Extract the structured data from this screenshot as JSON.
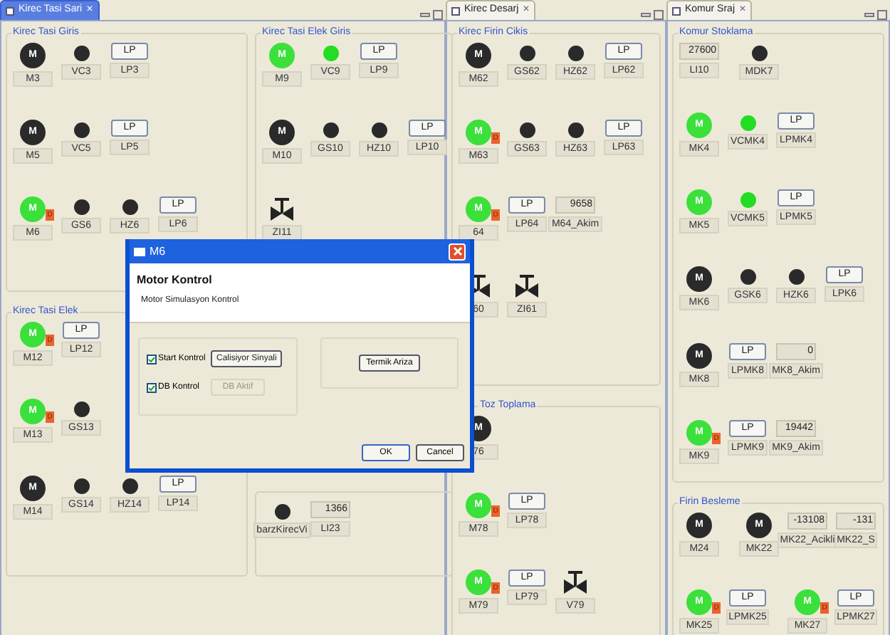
{
  "views": [
    {
      "tab": "Kirec Tasi Sari",
      "close": "✕",
      "selected": true,
      "groups": [
        {
          "title": "Kirec Tasi Giris",
          "rows": [
            [
              [
                {
                  "kind": "motor",
                  "symbol": "M",
                  "label": "M3",
                  "running": false
                },
                {
                  "kind": "indicator",
                  "label": "VC3",
                  "on": false
                },
                {
                  "kind": "lp",
                  "button": "LP",
                  "label": "LP3"
                }
              ]
            ],
            [
              [
                {
                  "kind": "motor",
                  "symbol": "M",
                  "label": "M5",
                  "running": false
                },
                {
                  "kind": "indicator",
                  "label": "VC5",
                  "on": false
                },
                {
                  "kind": "lp",
                  "button": "LP",
                  "label": "LP5"
                }
              ]
            ],
            [
              [
                {
                  "kind": "motor",
                  "symbol": "M",
                  "label": "M6",
                  "running": true,
                  "badge": "D"
                },
                {
                  "kind": "indicator",
                  "label": "GS6",
                  "on": false
                },
                {
                  "kind": "indicator",
                  "label": "HZ6",
                  "on": false
                },
                {
                  "kind": "lp",
                  "button": "LP",
                  "label": "LP6"
                }
              ]
            ]
          ]
        },
        {
          "title": "Kirec Tasi Elek Giris",
          "rows": [
            [
              [
                {
                  "kind": "motor",
                  "symbol": "M",
                  "label": "M9",
                  "running": true
                },
                {
                  "kind": "indicator",
                  "label": "VC9",
                  "on": true
                },
                {
                  "kind": "lp",
                  "button": "LP",
                  "label": "LP9"
                }
              ]
            ],
            [
              [
                {
                  "kind": "motor",
                  "symbol": "M",
                  "label": "M10",
                  "running": false
                },
                {
                  "kind": "indicator",
                  "label": "GS10",
                  "on": false
                },
                {
                  "kind": "indicator",
                  "label": "HZ10",
                  "on": false
                },
                {
                  "kind": "lp",
                  "button": "LP",
                  "label": "LP10"
                }
              ]
            ],
            [
              [
                {
                  "kind": "valve",
                  "label": "ZI11"
                }
              ]
            ]
          ]
        },
        {
          "title": "Kirec Tasi Elek",
          "rows": [
            [
              [
                {
                  "kind": "motor",
                  "symbol": "M",
                  "label": "M12",
                  "running": true,
                  "badge": "D"
                },
                {
                  "kind": "lp",
                  "button": "LP",
                  "label": "LP12"
                }
              ]
            ],
            [
              [
                {
                  "kind": "motor",
                  "symbol": "M",
                  "label": "M13",
                  "running": true,
                  "badge": "D"
                },
                {
                  "kind": "indicator",
                  "label": "GS13",
                  "on": false
                }
              ]
            ],
            [
              [
                {
                  "kind": "motor",
                  "symbol": "M",
                  "label": "M14",
                  "running": false
                },
                {
                  "kind": "indicator",
                  "label": "GS14",
                  "on": false
                },
                {
                  "kind": "indicator",
                  "label": "HZ14",
                  "on": false
                },
                {
                  "kind": "lp",
                  "button": "LP",
                  "label": "LP14"
                }
              ]
            ]
          ]
        },
        {
          "rows": [
            [
              [
                {
                  "kind": "indicator",
                  "label": "barzKirecVi",
                  "on": false
                },
                {
                  "kind": "value",
                  "value": "1366",
                  "label": "LI23"
                }
              ]
            ]
          ]
        }
      ]
    },
    {
      "tab": "Kirec Desarj",
      "close": "✕",
      "selected": false,
      "groups": [
        {
          "title": "Kirec Firin Cikis",
          "rows": [
            [
              [
                {
                  "kind": "motor",
                  "symbol": "M",
                  "label": "M62",
                  "running": false
                },
                {
                  "kind": "indicator",
                  "label": "GS62",
                  "on": false
                },
                {
                  "kind": "indicator",
                  "label": "HZ62",
                  "on": false
                },
                {
                  "kind": "lp",
                  "button": "LP",
                  "label": "LP62"
                }
              ]
            ],
            [
              [
                {
                  "kind": "motor",
                  "symbol": "M",
                  "label": "M63",
                  "running": true,
                  "badge": "D"
                },
                {
                  "kind": "indicator",
                  "label": "GS63",
                  "on": false
                },
                {
                  "kind": "indicator",
                  "label": "HZ63",
                  "on": false
                },
                {
                  "kind": "lp",
                  "button": "LP",
                  "label": "LP63"
                }
              ]
            ],
            [
              [
                {
                  "kind": "motor",
                  "symbol": "M",
                  "label": "64",
                  "running": true,
                  "badge": "D"
                },
                {
                  "kind": "lp",
                  "button": "LP",
                  "label": "LP64"
                },
                {
                  "kind": "value",
                  "value": "9658",
                  "label": "M64_Akim"
                }
              ]
            ],
            [
              [
                {
                  "kind": "valve",
                  "label": "60"
                },
                {
                  "kind": "valve",
                  "label": "ZI61"
                }
              ]
            ]
          ]
        },
        {
          "title": "Toz Toplama",
          "rows": [
            [
              [
                {
                  "kind": "motor",
                  "symbol": "M",
                  "label": "76",
                  "running": false
                }
              ]
            ],
            [
              [
                {
                  "kind": "motor",
                  "symbol": "M",
                  "label": "M78",
                  "running": true,
                  "badge": "D"
                },
                {
                  "kind": "lp",
                  "button": "LP",
                  "label": "LP78"
                }
              ]
            ],
            [
              [
                {
                  "kind": "motor",
                  "symbol": "M",
                  "label": "M79",
                  "running": true,
                  "badge": "D"
                },
                {
                  "kind": "lp",
                  "button": "LP",
                  "label": "LP79"
                },
                {
                  "kind": "valve",
                  "label": "V79"
                }
              ]
            ]
          ]
        }
      ]
    },
    {
      "tab": "Komur Sraj",
      "close": "✕",
      "selected": false,
      "groups": [
        {
          "title": "Komur Stoklama",
          "rows": [
            [
              [
                {
                  "kind": "value",
                  "value": "27600",
                  "label": "LI10"
                }
              ],
              [
                {
                  "kind": "indicator",
                  "label": "MDK7",
                  "on": false
                }
              ]
            ],
            [
              [
                {
                  "kind": "motor",
                  "symbol": "M",
                  "label": "MK4",
                  "running": true
                },
                {
                  "kind": "indicator",
                  "label": "VCMK4",
                  "on": true
                },
                {
                  "kind": "lp",
                  "button": "LP",
                  "label": "LPMK4"
                }
              ]
            ],
            [
              [
                {
                  "kind": "motor",
                  "symbol": "M",
                  "label": "MK5",
                  "running": true
                },
                {
                  "kind": "indicator",
                  "label": "VCMK5",
                  "on": true
                },
                {
                  "kind": "lp",
                  "button": "LP",
                  "label": "LPMK5"
                }
              ]
            ],
            [
              [
                {
                  "kind": "motor",
                  "symbol": "M",
                  "label": "MK6",
                  "running": false
                },
                {
                  "kind": "indicator",
                  "label": "GSK6",
                  "on": false
                },
                {
                  "kind": "indicator",
                  "label": "HZK6",
                  "on": false
                },
                {
                  "kind": "lp",
                  "button": "LP",
                  "label": "LPK6"
                }
              ]
            ],
            [
              [
                {
                  "kind": "motor",
                  "symbol": "M",
                  "label": "MK8",
                  "running": false
                },
                {
                  "kind": "lp",
                  "button": "LP",
                  "label": "LPMK8"
                },
                {
                  "kind": "value",
                  "value": "0",
                  "label": "MK8_Akim"
                }
              ]
            ],
            [
              [
                {
                  "kind": "motor",
                  "symbol": "M",
                  "label": "MK9",
                  "running": true,
                  "badge": "D"
                },
                {
                  "kind": "lp",
                  "button": "LP",
                  "label": "LPMK9"
                },
                {
                  "kind": "value",
                  "value": "19442",
                  "label": "MK9_Akim"
                }
              ]
            ]
          ]
        },
        {
          "title": "Firin Besleme",
          "rows": [
            [
              [
                {
                  "kind": "motor",
                  "symbol": "M",
                  "label": "M24",
                  "running": false
                }
              ],
              [
                {
                  "kind": "motor",
                  "symbol": "M",
                  "label": "MK22",
                  "running": false
                },
                {
                  "kind": "value",
                  "value": "-13108",
                  "label": "MK22_Acikli"
                },
                {
                  "kind": "value",
                  "value": "-131",
                  "label": "MK22_S"
                }
              ]
            ],
            [
              [
                {
                  "kind": "motor",
                  "symbol": "M",
                  "label": "MK25",
                  "running": true,
                  "badge": "D"
                },
                {
                  "kind": "lp",
                  "button": "LP",
                  "label": "LPMK25"
                }
              ],
              [
                {
                  "kind": "motor",
                  "symbol": "M",
                  "label": "MK27",
                  "running": true,
                  "badge": "D"
                },
                {
                  "kind": "lp",
                  "button": "LP",
                  "label": "LPMK27"
                }
              ]
            ]
          ]
        }
      ]
    }
  ],
  "dialog": {
    "title": "M6",
    "heading": "Motor Kontrol",
    "subtitle": "Motor Simulasyon Kontrol",
    "checks": [
      {
        "label": "Start Kontrol",
        "checked": true,
        "button": "Calisiyor Sinyali",
        "disabled": false
      },
      {
        "label": "DB Kontrol",
        "checked": true,
        "button": "DB Aktif",
        "disabled": true
      }
    ],
    "fault_button": "Termik Ariza",
    "buttons": [
      "OK",
      "Cancel"
    ]
  }
}
